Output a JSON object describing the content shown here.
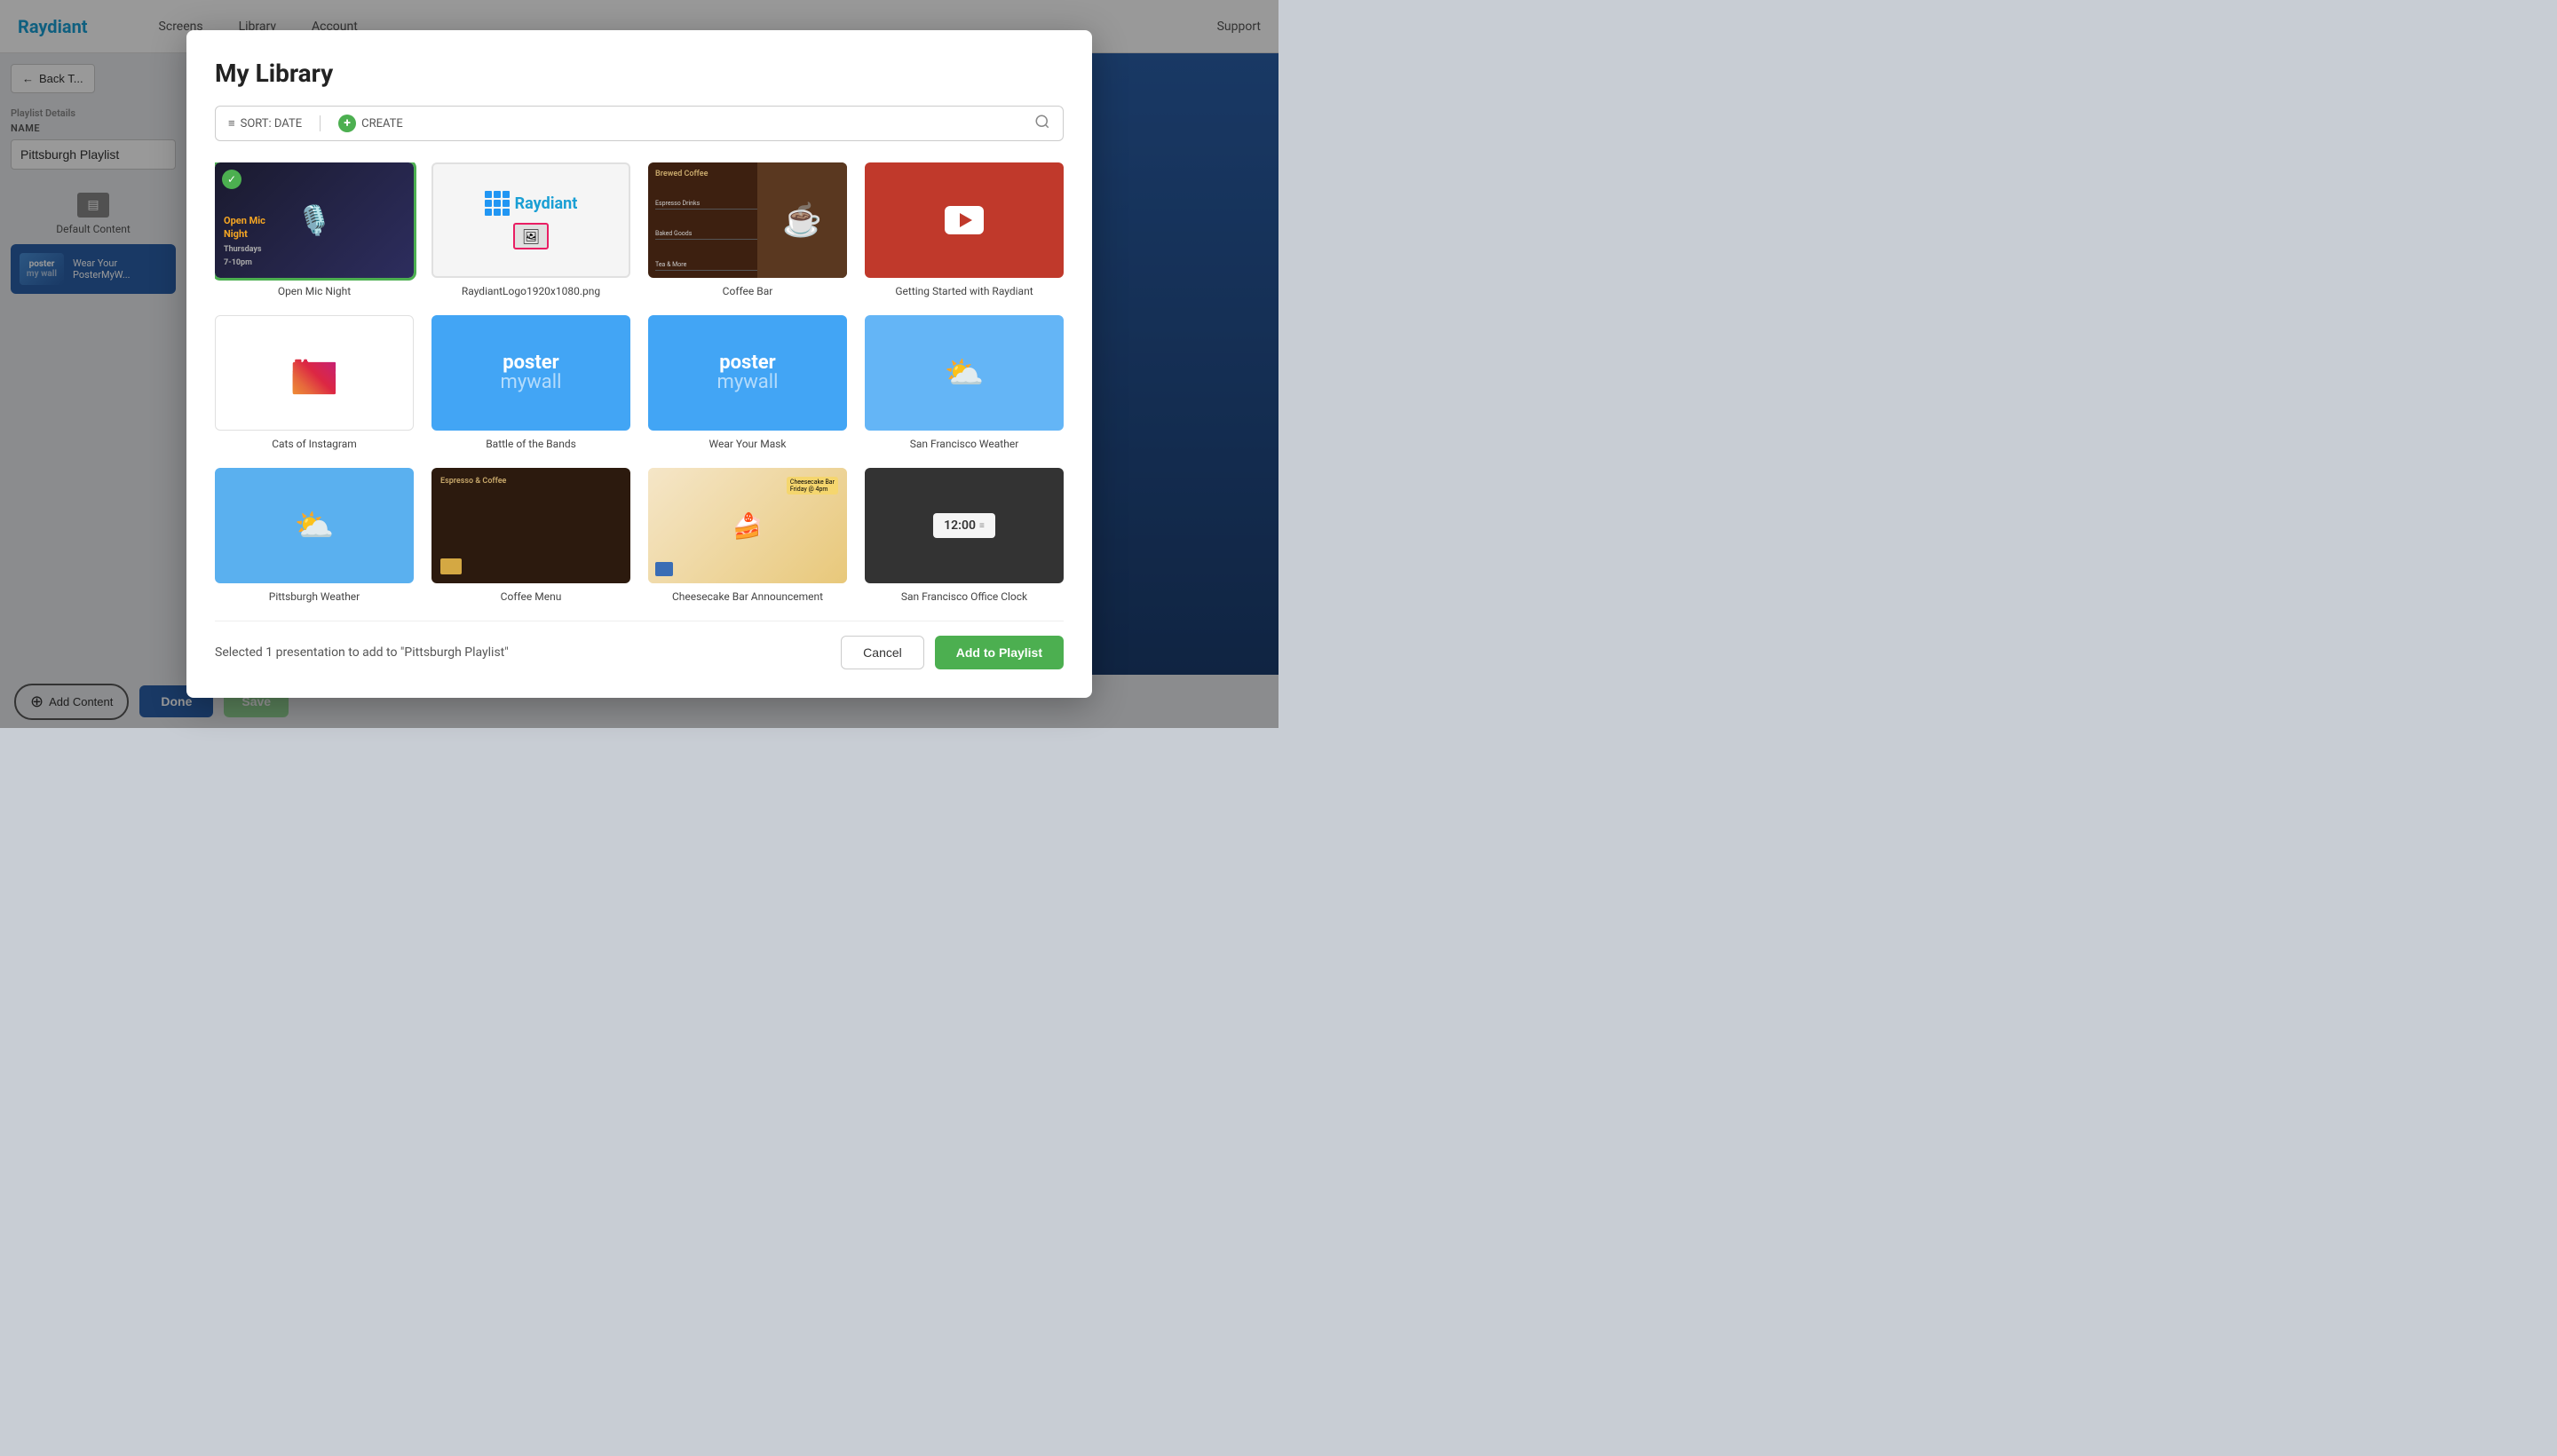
{
  "brand": "Raydiant",
  "nav": {
    "links": [
      "Screens",
      "Library",
      "Account"
    ],
    "support": "Support"
  },
  "sidebar": {
    "back_label": "Back T...",
    "section_label": "Playlist Details",
    "name_label": "NAME",
    "playlist_name": "Pittsburgh Playlist",
    "default_content_label": "Default Content",
    "playlist_item": {
      "line1": "poster",
      "line2": "my wall",
      "label1": "Wear Your",
      "label2": "PosterMyW..."
    }
  },
  "modal": {
    "title": "My Library",
    "toolbar": {
      "sort_label": "SORT: DATE",
      "create_label": "CREATE",
      "search_placeholder": "Search..."
    },
    "items": [
      {
        "id": "open-mic-night",
        "label": "Open Mic Night",
        "selected": true
      },
      {
        "id": "raydiant-logo",
        "label": "RaydiantLogo1920x1080.png",
        "selected": false
      },
      {
        "id": "coffee-bar",
        "label": "Coffee Bar",
        "selected": false
      },
      {
        "id": "getting-started",
        "label": "Getting Started with Raydiant",
        "selected": false
      },
      {
        "id": "cats-of-instagram",
        "label": "Cats of Instagram",
        "selected": false
      },
      {
        "id": "battle-of-bands",
        "label": "Battle of the Bands",
        "selected": false
      },
      {
        "id": "wear-your-mask",
        "label": "Wear Your Mask",
        "selected": false
      },
      {
        "id": "san-francisco-weather",
        "label": "San Francisco Weather",
        "selected": false
      },
      {
        "id": "pittsburgh-weather",
        "label": "Pittsburgh Weather",
        "selected": false
      },
      {
        "id": "coffee-menu",
        "label": "Coffee Menu",
        "selected": false
      },
      {
        "id": "cheesecake-bar",
        "label": "Cheesecake Bar Announcement",
        "selected": false
      },
      {
        "id": "sf-office-clock",
        "label": "San Francisco Office Clock",
        "selected": false
      }
    ],
    "footer": {
      "selected_info": "Selected 1 presentation to add to \"Pittsburgh Playlist\"",
      "cancel_label": "Cancel",
      "add_label": "Add to Playlist"
    }
  },
  "bottom_bar": {
    "add_content_label": "Add Content",
    "done_label": "Done",
    "save_label": "Save"
  }
}
